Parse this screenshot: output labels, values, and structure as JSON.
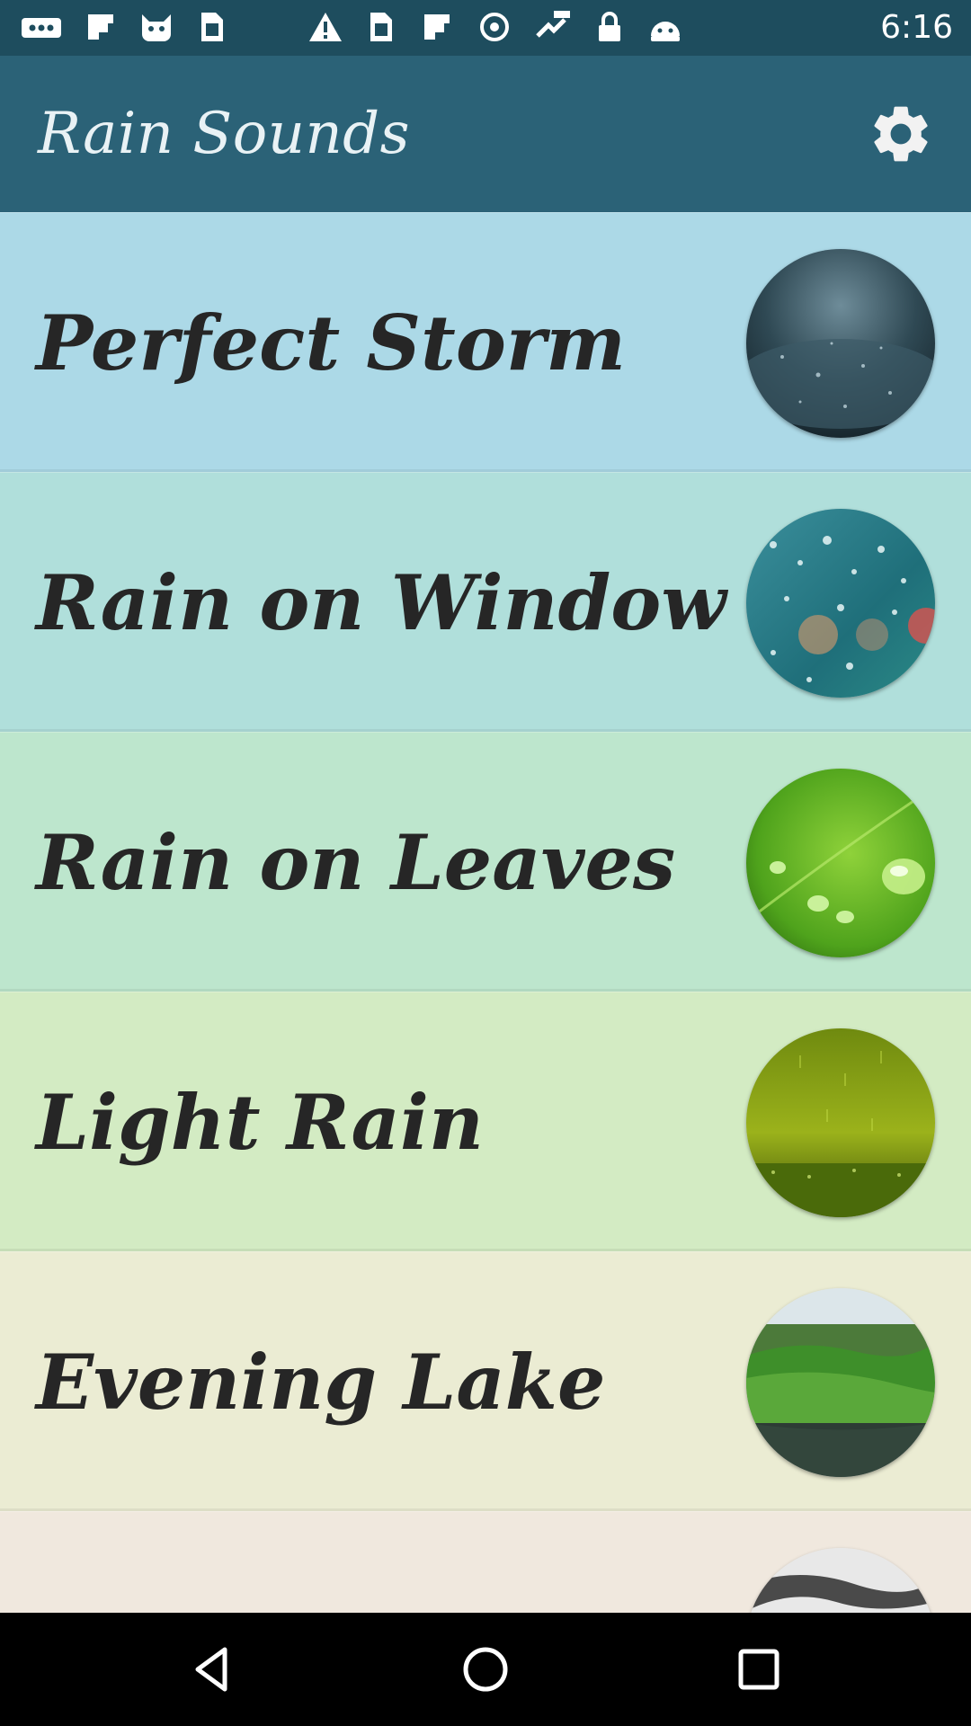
{
  "status_bar": {
    "time": "6:16",
    "icons": [
      "more-icon",
      "flipboard-icon",
      "cat-icon",
      "sim-icon",
      "warning-icon",
      "sim-icon",
      "flipboard-icon",
      "data-saver-icon",
      "fake-gps-icon",
      "lock-icon",
      "android-icon"
    ]
  },
  "app_bar": {
    "title": "Rain Sounds",
    "settings_icon": "gear-icon"
  },
  "sounds": [
    {
      "label": "Perfect Storm",
      "bg": "#acd9e7"
    },
    {
      "label": "Rain on Window",
      "bg": "#b0dfdb"
    },
    {
      "label": "Rain on Leaves",
      "bg": "#bde6cd"
    },
    {
      "label": "Light Rain",
      "bg": "#d3ebc3"
    },
    {
      "label": "Evening Lake",
      "bg": "#ebecd3"
    },
    {
      "label": "",
      "bg": "#f0e8de"
    }
  ],
  "nav_bar": {
    "back_icon": "back-triangle-icon",
    "home_icon": "home-circle-icon",
    "recents_icon": "recents-square-icon"
  }
}
